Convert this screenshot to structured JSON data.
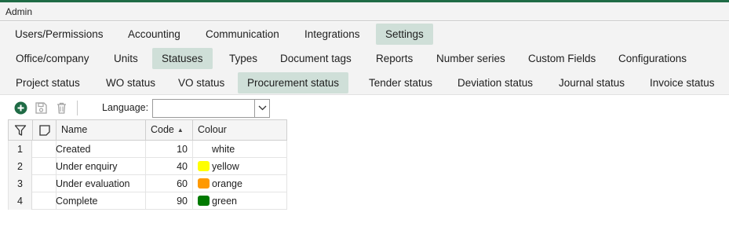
{
  "window": {
    "title": "Admin"
  },
  "tabs_row1": [
    {
      "label": "Users/Permissions",
      "active": false
    },
    {
      "label": "Accounting",
      "active": false
    },
    {
      "label": "Communication",
      "active": false
    },
    {
      "label": "Integrations",
      "active": false
    },
    {
      "label": "Settings",
      "active": true
    }
  ],
  "tabs_row2": [
    {
      "label": "Office/company",
      "active": false
    },
    {
      "label": "Units",
      "active": false
    },
    {
      "label": "Statuses",
      "active": true
    },
    {
      "label": "Types",
      "active": false
    },
    {
      "label": "Document tags",
      "active": false
    },
    {
      "label": "Reports",
      "active": false
    },
    {
      "label": "Number series",
      "active": false
    },
    {
      "label": "Custom Fields",
      "active": false
    },
    {
      "label": "Configurations",
      "active": false
    }
  ],
  "tabs_row3": [
    {
      "label": "Project status",
      "active": false
    },
    {
      "label": "WO status",
      "active": false
    },
    {
      "label": "VO status",
      "active": false
    },
    {
      "label": "Procurement status",
      "active": true
    },
    {
      "label": "Tender status",
      "active": false
    },
    {
      "label": "Deviation status",
      "active": false
    },
    {
      "label": "Journal status",
      "active": false
    },
    {
      "label": "Invoice status",
      "active": false
    }
  ],
  "toolbar": {
    "icons": [
      "add-icon",
      "save-icon",
      "delete-icon"
    ],
    "language_label": "Language:",
    "language_value": ""
  },
  "grid": {
    "columns": {
      "name": "Name",
      "code": "Code",
      "colour": "Colour"
    },
    "sort": {
      "column": "Code",
      "direction": "ascending"
    },
    "rows": [
      {
        "num": "1",
        "name": "Created",
        "code": "10",
        "colour": "white",
        "swatch": ""
      },
      {
        "num": "2",
        "name": "Under enquiry",
        "code": "40",
        "colour": "yellow",
        "swatch": "#ffff00"
      },
      {
        "num": "3",
        "name": "Under evaluation",
        "code": "60",
        "colour": "orange",
        "swatch": "#ff9900"
      },
      {
        "num": "4",
        "name": "Complete",
        "code": "90",
        "colour": "green",
        "swatch": "#007a00"
      }
    ]
  },
  "colors": {
    "accent_green": "#1f6b45",
    "active_tab": "#cfdfd8"
  }
}
